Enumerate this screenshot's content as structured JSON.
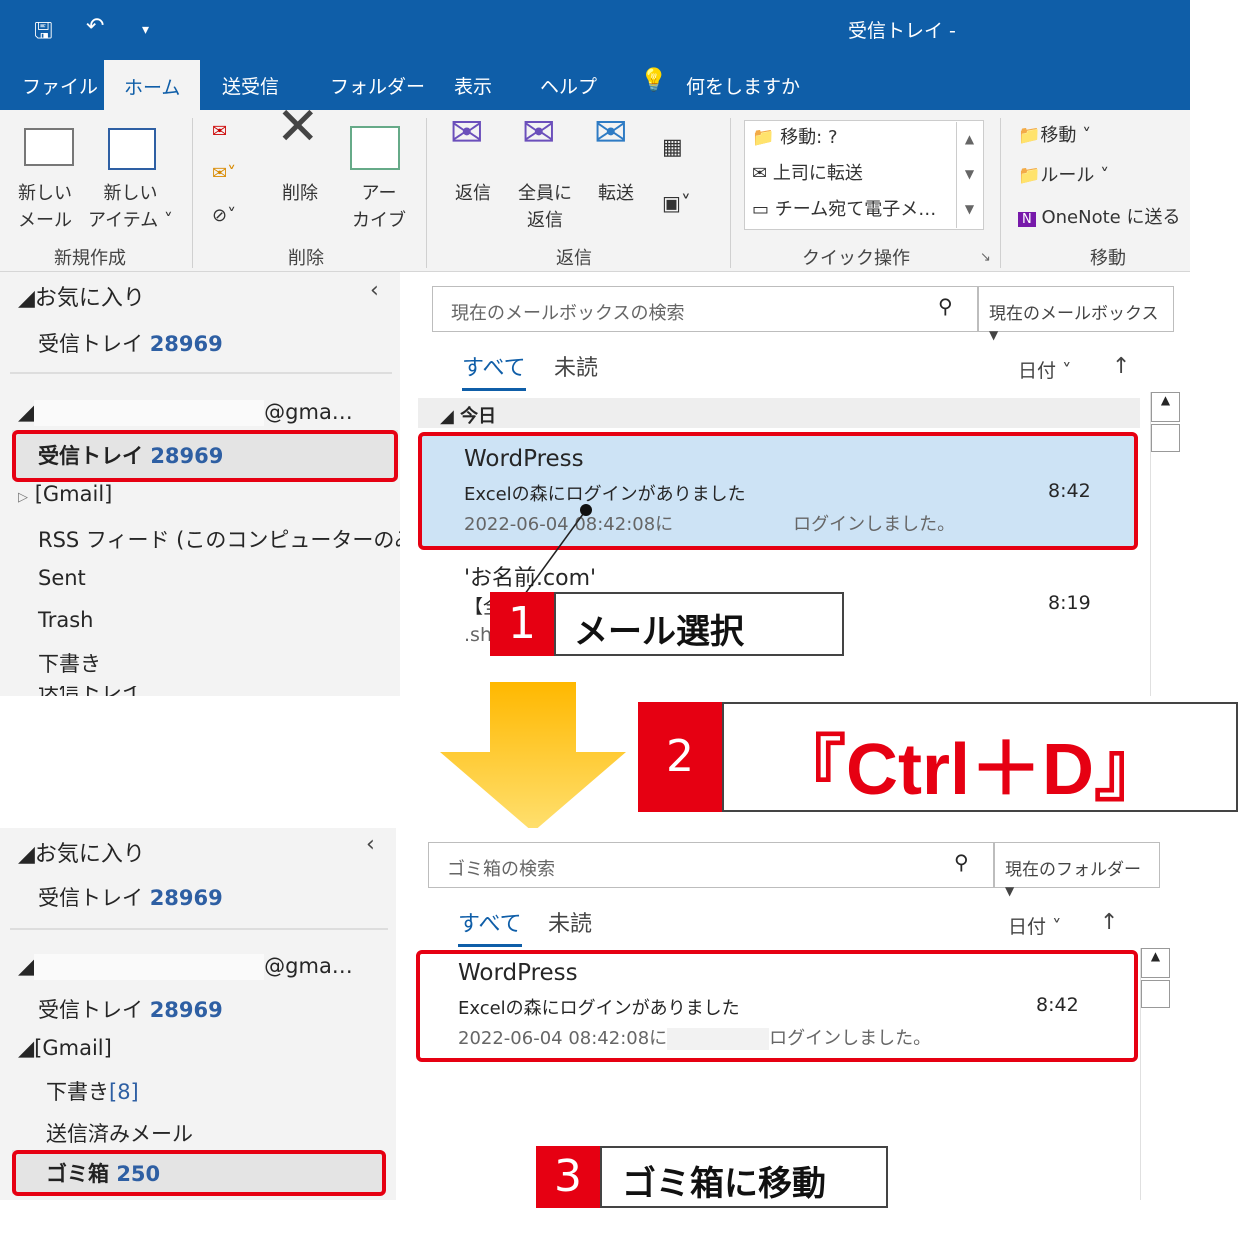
{
  "window": {
    "title": "受信トレイ -"
  },
  "tabs": [
    "ファイル",
    "ホーム",
    "送受信",
    "フォルダー",
    "表示",
    "ヘルプ",
    "何をしますか"
  ],
  "ribbon": {
    "new_mail": [
      "新しい",
      "メール"
    ],
    "new_item": [
      "新しい",
      "アイテム ˅"
    ],
    "delete": "削除",
    "archive": [
      "アー",
      "カイブ"
    ],
    "reply": "返信",
    "reply_all": [
      "全員に",
      "返信"
    ],
    "forward": "転送",
    "quick": [
      "移動: ?",
      "上司に転送",
      "チーム宛て電子メ…"
    ],
    "move_menu": [
      "移動 ˅",
      "ルール ˅",
      "OneNote に送る"
    ],
    "groups": [
      "新規作成",
      "削除",
      "返信",
      "クイック操作",
      "移動"
    ]
  },
  "top": {
    "favorites": "お気に入り",
    "fav_inbox": "受信トレイ",
    "fav_inbox_count": "28969",
    "account": "@gma…",
    "inbox": "受信トレイ",
    "inbox_count": "28969",
    "folders": [
      "[Gmail]",
      "RSS フィード (このコンピューターのみ)",
      "Sent",
      "Trash",
      "下書き",
      "送信トレイ"
    ],
    "search_placeholder": "現在のメールボックスの検索",
    "scope": "現在のメールボックス",
    "tab_all": "すべて",
    "tab_unread": "未読",
    "sort": "日付 ˅",
    "sort_dir": "↑",
    "group_today": "今日",
    "mail1": {
      "sender": "WordPress",
      "subject": "Excelの森にログインがありました",
      "preview_left": "2022-06-04 08:42:08に",
      "preview_right": "ログインしました。",
      "time": "8:42"
    },
    "mail2": {
      "sender": "'お名前.com'",
      "subject": "【全",
      "preview": ".sh",
      "time": "8:19"
    }
  },
  "bottom": {
    "favorites": "お気に入り",
    "fav_inbox": "受信トレイ",
    "fav_inbox_count": "28969",
    "account": "@gma…",
    "inbox": "受信トレイ",
    "inbox_count": "28969",
    "gmail": "[Gmail]",
    "drafts": "下書き",
    "drafts_count": "[8]",
    "sent": "送信済みメール",
    "trash": "ゴミ箱",
    "trash_count": "250",
    "search_placeholder": "ゴミ箱の検索",
    "scope": "現在のフォルダー",
    "tab_all": "すべて",
    "tab_unread": "未読",
    "sort": "日付 ˅",
    "sort_dir": "↑",
    "mail1": {
      "sender": "WordPress",
      "subject": "Excelの森にログインがありました",
      "preview_left": "2022-06-04 08:42:08に",
      "preview_right": "ログインしました。",
      "time": "8:42"
    }
  },
  "callouts": {
    "c1_num": "1",
    "c1_text": "メール選択",
    "c2_num": "2",
    "c2_text": "『Ctrl＋D』",
    "c3_num": "3",
    "c3_text": "ゴミ箱に移動"
  }
}
